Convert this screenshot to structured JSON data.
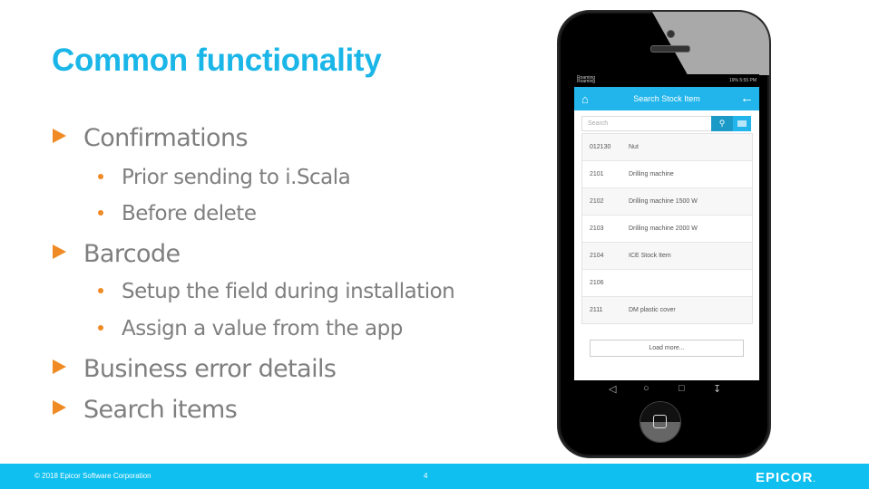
{
  "slide": {
    "title": "Common functionality",
    "bullets": [
      {
        "text": "Confirmations",
        "children": [
          "Prior sending to i.Scala",
          "Before delete"
        ]
      },
      {
        "text": "Barcode",
        "children": [
          "Setup the field during installation",
          "Assign a value from the app"
        ]
      },
      {
        "text": "Business error details",
        "children": []
      },
      {
        "text": "Search items",
        "children": []
      }
    ]
  },
  "footer": {
    "copyright": "© 2018 Epicor Software Corporation",
    "page_number": "4",
    "logo": "EPICOR",
    "logo_mark": "."
  },
  "colors": {
    "title": "#1bb6e8",
    "accent": "#f08a24",
    "footer_bg": "#0fbfef",
    "app_bar": "#22b5eb"
  },
  "phone": {
    "status_left": [
      "Roaming",
      "Roaming"
    ],
    "status_right": "19% 5:55 PM",
    "app_title": "Search Stock Item",
    "search_placeholder": "Search",
    "items": [
      {
        "code": "012130",
        "name": "Nut"
      },
      {
        "code": "2101",
        "name": "Drilling machine"
      },
      {
        "code": "2102",
        "name": "Drilling machine 1500 W"
      },
      {
        "code": "2103",
        "name": "Drilling machine 2000 W"
      },
      {
        "code": "2104",
        "name": "ICE Stock Item"
      },
      {
        "code": "2106",
        "name": ""
      },
      {
        "code": "2111",
        "name": "DM plastic cover"
      }
    ],
    "load_more": "Load more...",
    "nav": [
      "back-icon",
      "home-icon",
      "recents-icon",
      "notifications-icon"
    ]
  }
}
